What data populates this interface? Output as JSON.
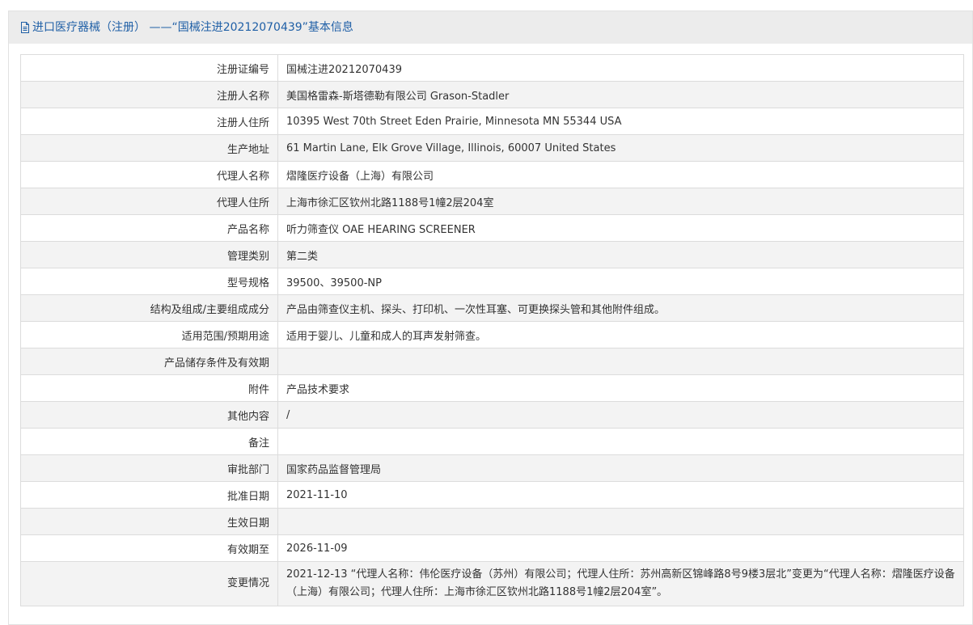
{
  "header": {
    "icon": "document-icon",
    "title": "进口医疗器械（注册） ——“国械注进20212070439”基本信息"
  },
  "colors": {
    "header_text": "#1f5fa6",
    "panel_bg": "#ececec",
    "row_alt": "#f3f3f3",
    "border": "#dcdcdc"
  },
  "rows": [
    {
      "label": "注册证编号",
      "value": "国械注进20212070439"
    },
    {
      "label": "注册人名称",
      "value": "美国格雷森-斯塔德勒有限公司 Grason-Stadler"
    },
    {
      "label": "注册人住所",
      "value": "10395 West 70th Street Eden Prairie, Minnesota MN 55344 USA"
    },
    {
      "label": "生产地址",
      "value": "61 Martin Lane, Elk Grove Village, Illinois, 60007 United States"
    },
    {
      "label": "代理人名称",
      "value": "熠隆医疗设备（上海）有限公司"
    },
    {
      "label": "代理人住所",
      "value": "上海市徐汇区钦州北路1188号1幢2层204室"
    },
    {
      "label": "产品名称",
      "value": "听力筛查仪 OAE HEARING SCREENER"
    },
    {
      "label": "管理类别",
      "value": "第二类"
    },
    {
      "label": "型号规格",
      "value": "39500、39500-NP"
    },
    {
      "label": "结构及组成/主要组成成分",
      "value": "产品由筛查仪主机、探头、打印机、一次性耳塞、可更换探头管和其他附件组成。"
    },
    {
      "label": "适用范围/预期用途",
      "value": "适用于婴儿、儿童和成人的耳声发射筛查。"
    },
    {
      "label": "产品储存条件及有效期",
      "value": ""
    },
    {
      "label": "附件",
      "value": "产品技术要求"
    },
    {
      "label": "其他内容",
      "value": "/"
    },
    {
      "label": "备注",
      "value": ""
    },
    {
      "label": "审批部门",
      "value": "国家药品监督管理局"
    },
    {
      "label": "批准日期",
      "value": "2021-11-10"
    },
    {
      "label": "生效日期",
      "value": ""
    },
    {
      "label": "有效期至",
      "value": "2026-11-09"
    },
    {
      "label": "变更情况",
      "value": "2021-12-13 “代理人名称：伟伦医疗设备（苏州）有限公司；代理人住所：苏州高新区锦峰路8号9楼3层北”变更为“代理人名称：熠隆医疗设备（上海）有限公司；代理人住所：上海市徐汇区钦州北路1188号1幢2层204室”。"
    }
  ]
}
